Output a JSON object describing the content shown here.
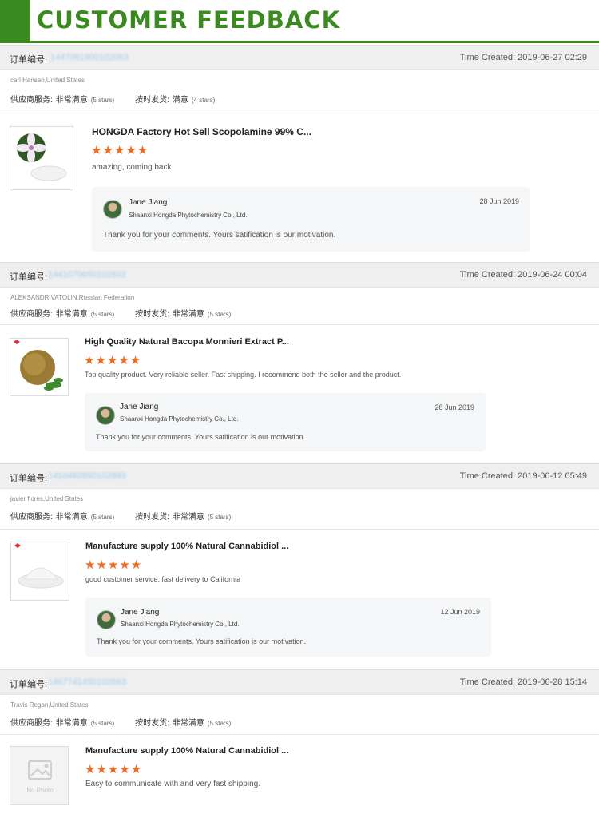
{
  "header": {
    "title": "CUSTOMER FEEDBACK"
  },
  "order_label": "订单编号:",
  "time_prefix": "Time Created:",
  "supplier_label": "供应商服务:",
  "shipping_label": "按时发货:",
  "stars_glyph": "★★★★★",
  "no_photo_label": "No Photo",
  "orders": [
    {
      "order_no": "1447091900102063",
      "time": "2019-06-27 02:29",
      "buyer": "carl Hansen,United States",
      "supplier_rating": "非常满意",
      "supplier_stars": "(5 stars)",
      "shipping_rating": "满意",
      "shipping_stars": "(4 stars)",
      "product": "HONGDA Factory Hot Sell Scopolamine 99% C...",
      "comment": "amazing, coming back",
      "reply": {
        "name": "Jane Jiang",
        "company": "Shaanxi Hongda Phytochemistry Co., Ltd.",
        "date": "28 Jun 2019",
        "message": "Thank you for your comments. Yours satification is our motivation."
      }
    },
    {
      "order_no": "1441070650102602",
      "time": "2019-06-24 00:04",
      "buyer": "ALEKSANDR VATOLIN,Russian Federation",
      "supplier_rating": "非常满意",
      "supplier_stars": "(5 stars)",
      "shipping_rating": "非常满意",
      "shipping_stars": "(5 stars)",
      "product": "High Quality Natural Bacopa Monnieri Extract P...",
      "comment": "Top quality product.  Very reliable seller.  Fast shipping.  I recommend both the seller and the product.",
      "reply": {
        "name": "Jane Jiang",
        "company": "Shaanxi Hongda Phytochemistry Co., Ltd.",
        "date": "28 Jun 2019",
        "message": "Thank you for your comments. Yours satification is our motivation."
      }
    },
    {
      "order_no": "1410482650102893",
      "time": "2019-06-12 05:49",
      "buyer": "javier flores,United States",
      "supplier_rating": "非常满意",
      "supplier_stars": "(5 stars)",
      "shipping_rating": "非常满意",
      "shipping_stars": "(5 stars)",
      "product": "Manufacture supply 100% Natural Cannabidiol ...",
      "comment": "good customer service. fast delivery to California",
      "reply": {
        "name": "Jane Jiang",
        "company": "Shaanxi Hongda Phytochemistry Co., Ltd.",
        "date": "12 Jun 2019",
        "message": "Thank you for your comments. Yours satification is our motivation."
      }
    },
    {
      "order_no": "1467741450102663",
      "time": "2019-06-28 15:14",
      "buyer": "Travis Regan,United States",
      "supplier_rating": "非常满意",
      "supplier_stars": "(5 stars)",
      "shipping_rating": "非常满意",
      "shipping_stars": "(5 stars)",
      "product": "Manufacture supply 100% Natural Cannabidiol ...",
      "comment": "Easy to communicate with and very fast shipping."
    }
  ]
}
